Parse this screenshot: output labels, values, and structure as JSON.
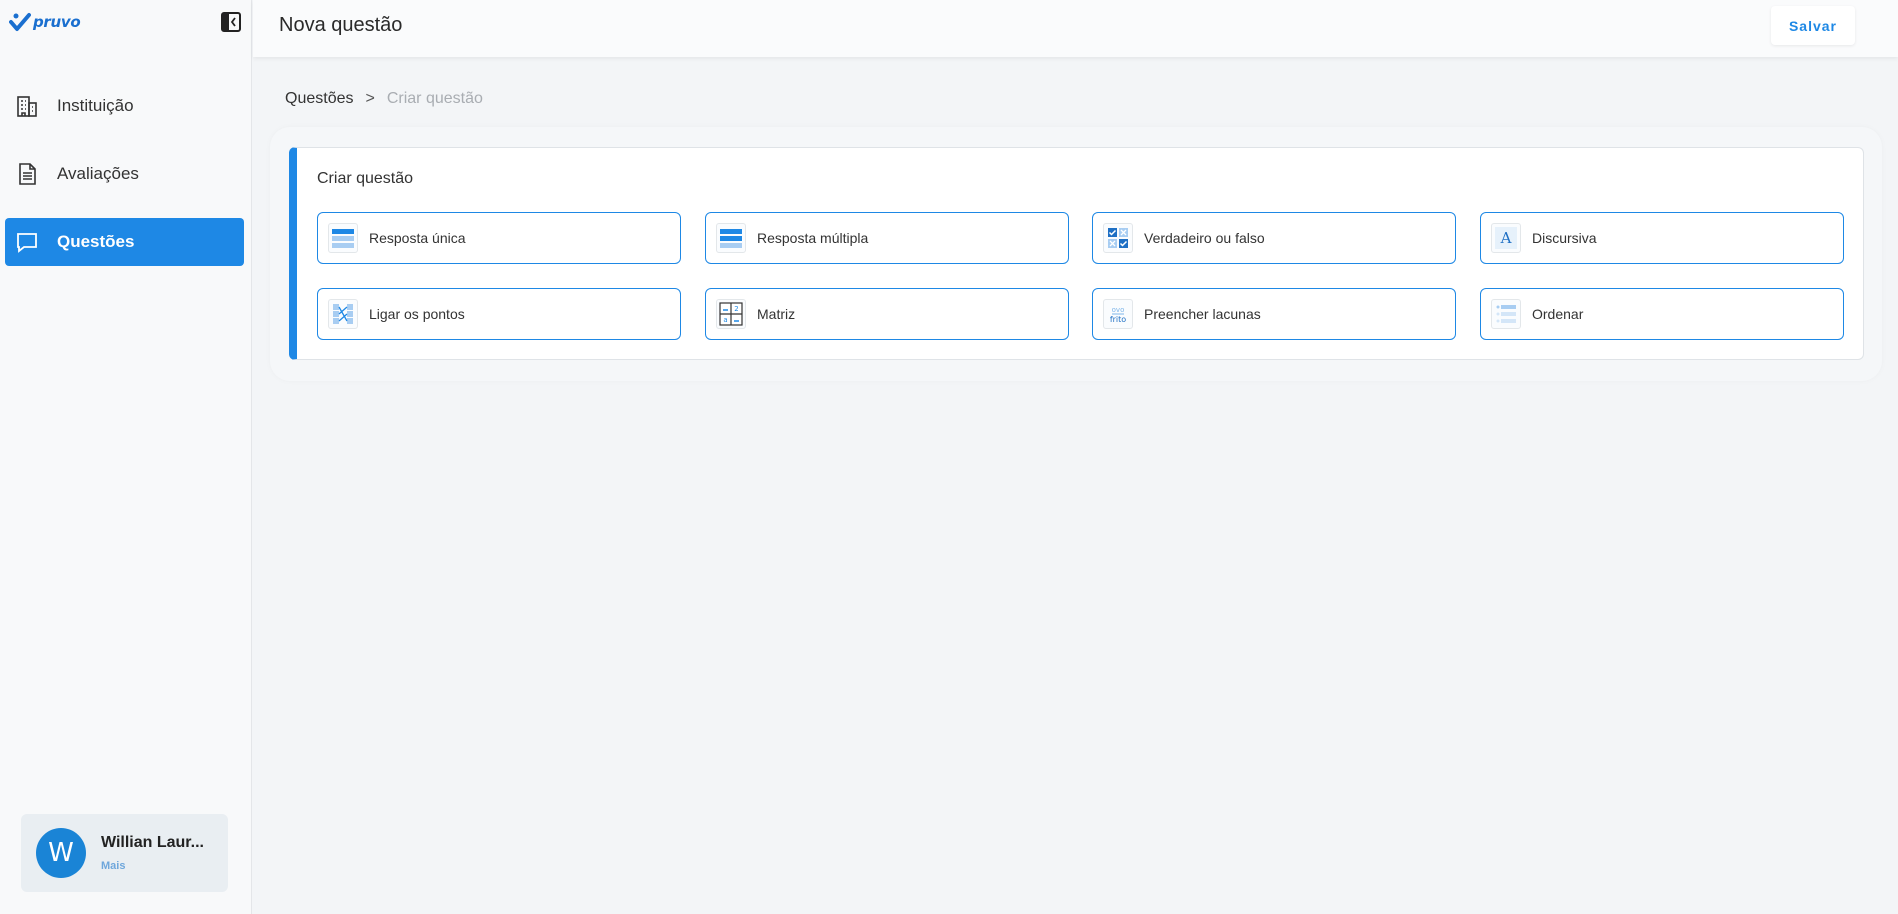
{
  "sidebar": {
    "logo_text": "pruvo",
    "items": [
      {
        "label": "Instituição",
        "icon": "building-icon",
        "active": false
      },
      {
        "label": "Avaliações",
        "icon": "document-icon",
        "active": false
      },
      {
        "label": "Questões",
        "icon": "chat-icon",
        "active": true
      }
    ],
    "user": {
      "initial": "W",
      "name": "Willian Laur...",
      "more_label": "Mais"
    }
  },
  "header": {
    "title": "Nova questão",
    "save_label": "Salvar"
  },
  "breadcrumb": {
    "items": [
      "Questões",
      "Criar questão"
    ],
    "separator": ">"
  },
  "card": {
    "title": "Criar questão",
    "options": [
      {
        "label": "Resposta única",
        "icon": "single-answer-icon"
      },
      {
        "label": "Resposta múltipla",
        "icon": "multiple-answer-icon"
      },
      {
        "label": "Verdadeiro ou falso",
        "icon": "true-false-icon"
      },
      {
        "label": "Discursiva",
        "icon": "essay-icon"
      },
      {
        "label": "Ligar os pontos",
        "icon": "connect-dots-icon"
      },
      {
        "label": "Matriz",
        "icon": "matrix-icon"
      },
      {
        "label": "Preencher lacunas",
        "icon": "fill-blanks-icon"
      },
      {
        "label": "Ordenar",
        "icon": "order-icon"
      }
    ]
  },
  "colors": {
    "accent": "#1e88e5",
    "avatar": "#1a84d6"
  }
}
